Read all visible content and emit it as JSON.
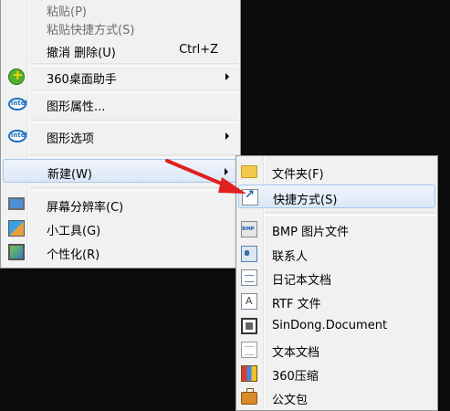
{
  "context_menu": {
    "items": [
      {
        "label": "粘贴(P)",
        "disabled": true
      },
      {
        "label": "粘贴快捷方式(S)",
        "disabled": true
      },
      {
        "label": "撤消 删除(U)",
        "shortcut": "Ctrl+Z"
      },
      {
        "label": "360桌面助手",
        "icon": "360-icon",
        "submenu": true
      },
      {
        "label": "图形属性...",
        "icon": "intel-icon"
      },
      {
        "label": "图形选项",
        "icon": "intel-icon",
        "submenu": true
      },
      {
        "label": "新建(W)",
        "submenu": true,
        "highlighted": true
      },
      {
        "label": "屏幕分辨率(C)",
        "icon": "monitor-icon"
      },
      {
        "label": "小工具(G)",
        "icon": "gadget-icon"
      },
      {
        "label": "个性化(R)",
        "icon": "personalize-icon"
      }
    ]
  },
  "new_submenu": {
    "items": [
      {
        "label": "文件夹(F)",
        "icon": "folder-icon"
      },
      {
        "label": "快捷方式(S)",
        "icon": "shortcut-icon",
        "highlighted": true
      },
      {
        "label": "BMP 图片文件",
        "icon": "bmp-file-icon"
      },
      {
        "label": "联系人",
        "icon": "contact-icon"
      },
      {
        "label": "日记本文档",
        "icon": "journal-icon"
      },
      {
        "label": "RTF 文件",
        "icon": "rtf-file-icon"
      },
      {
        "label": "SinDong.Document",
        "icon": "sindong-document-icon"
      },
      {
        "label": "文本文档",
        "icon": "text-document-icon"
      },
      {
        "label": "360压缩",
        "icon": "zip-archive-icon"
      },
      {
        "label": "公文包",
        "icon": "briefcase-icon"
      }
    ]
  },
  "colors": {
    "menu_background": "#f1f1f1",
    "highlight_border": "#a8c8ec",
    "annotation_arrow": "#e02020",
    "desktop_background": "#0d0d0d"
  }
}
